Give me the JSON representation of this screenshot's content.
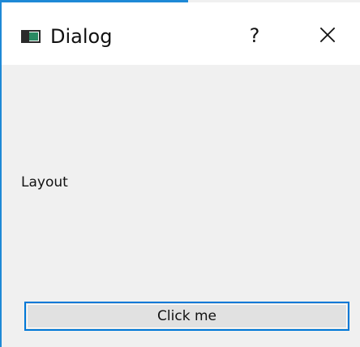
{
  "window": {
    "title": "Dialog",
    "help_symbol": "?",
    "close_icon": "close-icon",
    "app_icon": "window-app-icon"
  },
  "content": {
    "label": "Layout",
    "button_label": "Click me"
  },
  "colors": {
    "accent": "#1e89d6",
    "focus_border": "#0078d7",
    "content_background": "#f0f0f0",
    "titlebar_background": "#ffffff",
    "button_background": "#e1e1e1",
    "icon_green": "#2a8a63"
  }
}
